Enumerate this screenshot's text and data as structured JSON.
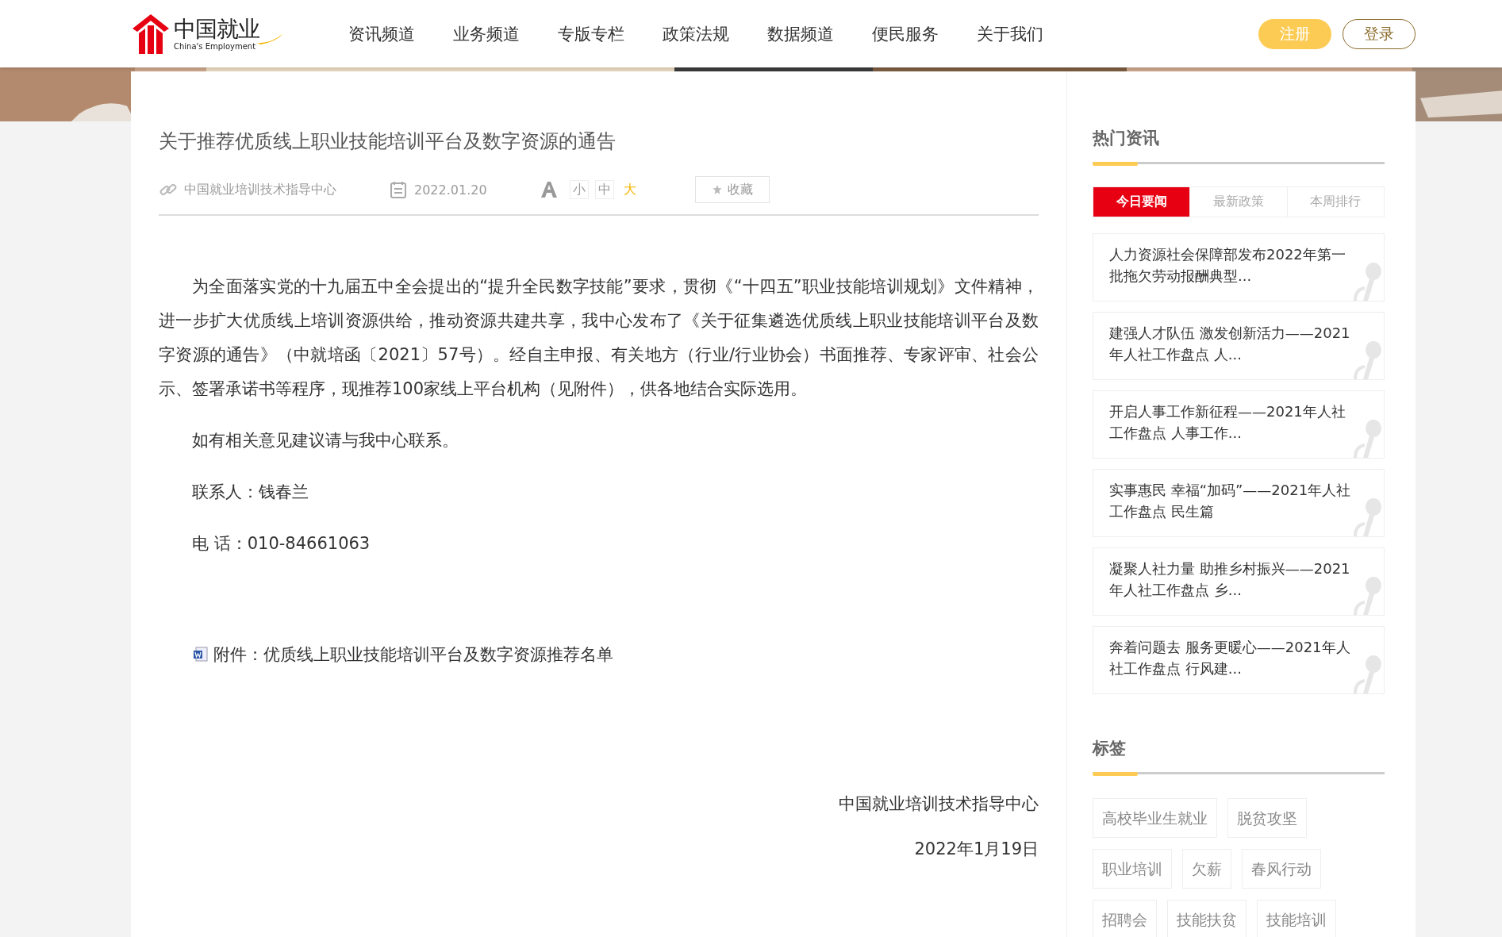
{
  "header": {
    "logo": {
      "name": "中国就业",
      "subtitle": "China's Employment"
    },
    "nav": [
      {
        "label": "资讯频道"
      },
      {
        "label": "业务频道"
      },
      {
        "label": "专版专栏"
      },
      {
        "label": "政策法规"
      },
      {
        "label": "数据频道"
      },
      {
        "label": "便民服务"
      },
      {
        "label": "关于我们"
      }
    ],
    "buttons": [
      {
        "label": "注册",
        "kind": "primary"
      },
      {
        "label": "登录",
        "kind": "outline"
      }
    ]
  },
  "article": {
    "title": "关于推荐优质线上职业技能培训平台及数字资源的通告",
    "meta": {
      "source": "中国就业培训技术指导中心",
      "date": "2022.01.20",
      "font_sizes": [
        {
          "label": "小",
          "selected": false
        },
        {
          "label": "中",
          "selected": false
        },
        {
          "label": "大",
          "selected": true
        }
      ],
      "favorite": "收藏"
    },
    "paragraphs": [
      "为全面落实党的十九届五中全会提出的“提升全民数字技能”要求，贯彻《“十四五”职业技能培训规划》文件精神，进一步扩大优质线上培训资源供给，推动资源共建共享，我中心发布了《关于征集遴选优质线上职业技能培训平台及数字资源的通告》（中就培函〔2021〕57号）。经自主申报、有关地方（行业/行业协会）书面推荐、专家评审、社会公示、签署承诺书等程序，现推荐100家线上平台机构（见附件），供各地结合实际选用。",
      "如有相关意见建议请与我中心联系。",
      "联系人：钱春兰",
      "电 话：010-84661063"
    ],
    "attachment": "附件：优质线上职业技能培训平台及数字资源推荐名单",
    "signature": {
      "org": "中国就业培训技术指导中心",
      "date": "2022年1月19日"
    }
  },
  "sidebar": {
    "hot": {
      "title": "热门资讯",
      "tabs": [
        {
          "label": "今日要闻",
          "selected": true
        },
        {
          "label": "最新政策",
          "selected": false
        },
        {
          "label": "本周排行",
          "selected": false
        }
      ],
      "items": [
        "人力资源社会保障部发布2022年第一批拖欠劳动报酬典型...",
        "建强人才队伍 激发创新活力——2021年人社工作盘点 人...",
        "开启人事工作新征程——2021年人社工作盘点 人事工作...",
        "实事惠民 幸福“加码”——2021年人社工作盘点 民生篇",
        "凝聚人社力量 助推乡村振兴——2021年人社工作盘点 乡...",
        "奔着问题去 服务更暖心——2021年人社工作盘点 行风建..."
      ]
    },
    "tags": {
      "title": "标签",
      "rows": [
        [
          "高校毕业生就业",
          "脱贫攻坚"
        ],
        [
          "职业培训",
          "欠薪",
          "春风行动"
        ],
        [
          "招聘会",
          "技能扶贫",
          "技能培训"
        ]
      ]
    }
  }
}
